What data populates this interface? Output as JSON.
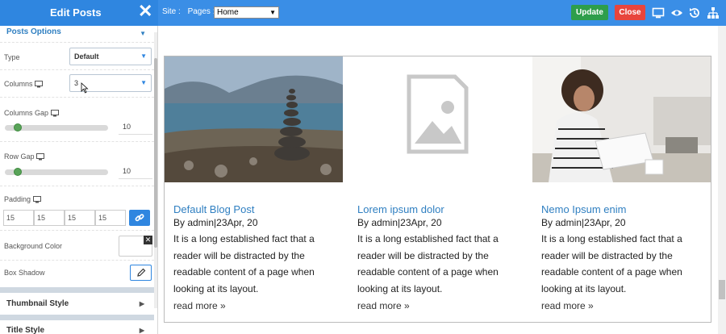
{
  "header": {
    "title": "Edit Posts",
    "site_label": "Site :",
    "pages_label": "Pages :",
    "pages_selected": "Home",
    "update_label": "Update",
    "close_label": "Close"
  },
  "sidebar": {
    "section_title": "Posts Options",
    "type": {
      "label": "Type",
      "value": "Default"
    },
    "columns": {
      "label": "Columns",
      "value": "3"
    },
    "columns_gap": {
      "label": "Columns Gap",
      "value": "10"
    },
    "row_gap": {
      "label": "Row Gap",
      "value": "10"
    },
    "padding": {
      "label": "Padding",
      "values": [
        "15",
        "15",
        "15",
        "15"
      ]
    },
    "background_color": {
      "label": "Background Color"
    },
    "box_shadow": {
      "label": "Box Shadow"
    },
    "thumbnail_style": "Thumbnail Style",
    "title_style": "Title Style"
  },
  "posts": [
    {
      "title": "Default Blog Post",
      "meta": "By admin|23Apr, 20",
      "lines": [
        "It is a long established fact that a",
        "reader will be distracted by the",
        "readable content of a page when",
        "looking at its layout."
      ],
      "read_more": "read more »"
    },
    {
      "title": "Lorem ipsum dolor",
      "meta": "By admin|23Apr, 20",
      "lines": [
        "It is a long established fact that a",
        "reader will be distracted by the",
        "readable content of a page when",
        "looking at its layout."
      ],
      "read_more": "read more »"
    },
    {
      "title": "Nemo Ipsum enim",
      "meta": "By admin|23Apr, 20",
      "lines": [
        "It is a long established fact that a",
        "reader will be distracted by the",
        "readable content of a page when",
        "looking at its layout."
      ],
      "read_more": "read more »"
    }
  ],
  "colors": {
    "accent": "#3a8ee6",
    "update": "#2e9e4b",
    "close": "#e8453c",
    "link": "#2f7fc1"
  }
}
